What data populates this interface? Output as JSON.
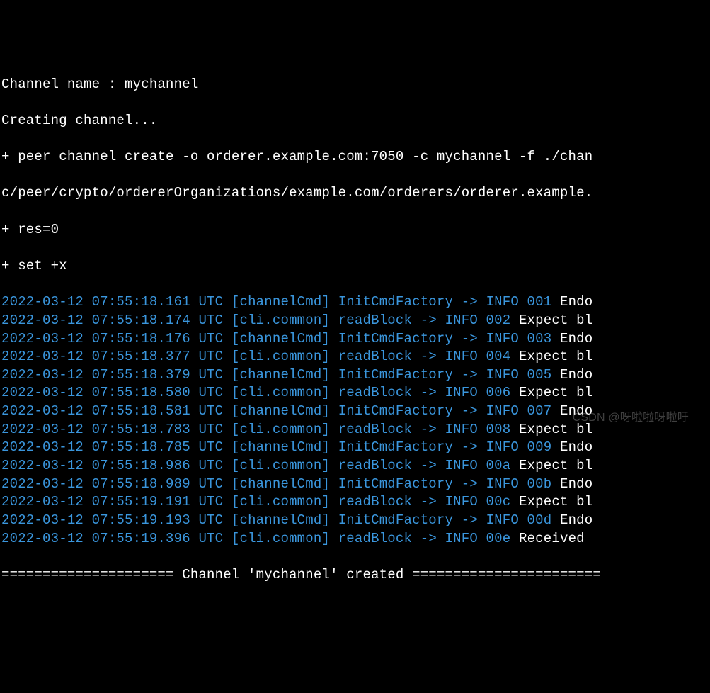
{
  "header": {
    "line1": "Channel name : mychannel",
    "line2": "Creating channel...",
    "line3": "+ peer channel create -o orderer.example.com:7050 -c mychannel -f ./chan",
    "line4": "c/peer/crypto/ordererOrganizations/example.com/orderers/orderer.example.",
    "line5": "+ res=0",
    "line6": "+ set +x"
  },
  "logs": [
    {
      "ts": "2022-03-12 07:55:18.161 UTC ",
      "mod": "[channelCmd] ",
      "fn": "InitCmdFactory ",
      "arrow": "-> ",
      "lvl": "INFO ",
      "id": "001",
      "msg": " Endo"
    },
    {
      "ts": "2022-03-12 07:55:18.174 UTC ",
      "mod": "[cli.common] ",
      "fn": "readBlock ",
      "arrow": "-> ",
      "lvl": "INFO ",
      "id": "002",
      "msg": " Expect bl"
    },
    {
      "ts": "2022-03-12 07:55:18.176 UTC ",
      "mod": "[channelCmd] ",
      "fn": "InitCmdFactory ",
      "arrow": "-> ",
      "lvl": "INFO ",
      "id": "003",
      "msg": " Endo"
    },
    {
      "ts": "2022-03-12 07:55:18.377 UTC ",
      "mod": "[cli.common] ",
      "fn": "readBlock ",
      "arrow": "-> ",
      "lvl": "INFO ",
      "id": "004",
      "msg": " Expect bl"
    },
    {
      "ts": "2022-03-12 07:55:18.379 UTC ",
      "mod": "[channelCmd] ",
      "fn": "InitCmdFactory ",
      "arrow": "-> ",
      "lvl": "INFO ",
      "id": "005",
      "msg": " Endo"
    },
    {
      "ts": "2022-03-12 07:55:18.580 UTC ",
      "mod": "[cli.common] ",
      "fn": "readBlock ",
      "arrow": "-> ",
      "lvl": "INFO ",
      "id": "006",
      "msg": " Expect bl"
    },
    {
      "ts": "2022-03-12 07:55:18.581 UTC ",
      "mod": "[channelCmd] ",
      "fn": "InitCmdFactory ",
      "arrow": "-> ",
      "lvl": "INFO ",
      "id": "007",
      "msg": " Endo"
    },
    {
      "ts": "2022-03-12 07:55:18.783 UTC ",
      "mod": "[cli.common] ",
      "fn": "readBlock ",
      "arrow": "-> ",
      "lvl": "INFO ",
      "id": "008",
      "msg": " Expect bl"
    },
    {
      "ts": "2022-03-12 07:55:18.785 UTC ",
      "mod": "[channelCmd] ",
      "fn": "InitCmdFactory ",
      "arrow": "-> ",
      "lvl": "INFO ",
      "id": "009",
      "msg": " Endo"
    },
    {
      "ts": "2022-03-12 07:55:18.986 UTC ",
      "mod": "[cli.common] ",
      "fn": "readBlock ",
      "arrow": "-> ",
      "lvl": "INFO ",
      "id": "00a",
      "msg": " Expect bl"
    },
    {
      "ts": "2022-03-12 07:55:18.989 UTC ",
      "mod": "[channelCmd] ",
      "fn": "InitCmdFactory ",
      "arrow": "-> ",
      "lvl": "INFO ",
      "id": "00b",
      "msg": " Endo"
    },
    {
      "ts": "2022-03-12 07:55:19.191 UTC ",
      "mod": "[cli.common] ",
      "fn": "readBlock ",
      "arrow": "-> ",
      "lvl": "INFO ",
      "id": "00c",
      "msg": " Expect bl"
    },
    {
      "ts": "2022-03-12 07:55:19.193 UTC ",
      "mod": "[channelCmd] ",
      "fn": "InitCmdFactory ",
      "arrow": "-> ",
      "lvl": "INFO ",
      "id": "00d",
      "msg": " Endo"
    },
    {
      "ts": "2022-03-12 07:55:19.396 UTC ",
      "mod": "[cli.common] ",
      "fn": "readBlock ",
      "arrow": "-> ",
      "lvl": "INFO ",
      "id": "00e",
      "msg": " Received "
    }
  ],
  "footer": {
    "text": "===================== Channel 'mychannel' created ======================="
  },
  "watermark": "CSDN @呀啦啦呀啦吁"
}
